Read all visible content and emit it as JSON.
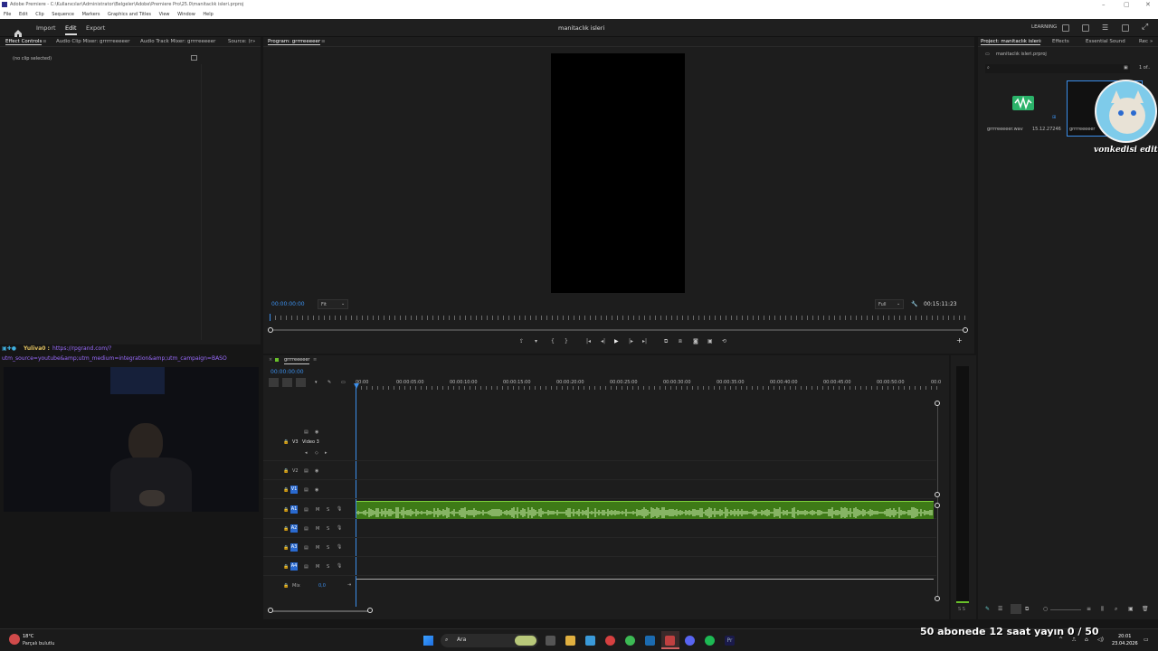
{
  "window": {
    "title": "Adobe Premiere - C:\\Kullanıcılar\\Administrator\\Belgeler\\Adobe\\Premiere Pro\\25.0\\manitaclık isleri.prproj"
  },
  "menu": [
    "File",
    "Edit",
    "Clip",
    "Sequence",
    "Markers",
    "Graphics and Titles",
    "View",
    "Window",
    "Help"
  ],
  "appbar": {
    "tabs": [
      "Import",
      "Edit",
      "Export"
    ],
    "project_title": "manitaclık isleri",
    "learning": "LEARNING"
  },
  "left_panel": {
    "tabs": [
      "Effect Controls",
      "Audio Clip Mixer: grrrrreeeeer",
      "Audio Track Mixer: grrrreeeeer",
      "Source: (r"
    ],
    "no_clip": "(no clip selected)"
  },
  "overlay": {
    "chat_user": "Yuliva0 :",
    "chat_link": "https://rpgrand.com/?",
    "chat_link_2": "utm_source=youtube&amp;utm_medium=integration&amp;utm_campaign=BASO",
    "stream_banner": "50 abonede 12 saat yayın 0 / 50",
    "streamer_tag": "vonkedisi edit"
  },
  "program": {
    "title": "Program: grrrreeeeer",
    "timecode": "00:00:00:00",
    "fit": "Fit",
    "quality": "Full",
    "duration": "00:15:11:23"
  },
  "timeline": {
    "sequence_name": "grrrreeeeer",
    "timecode": "00:00:00:00",
    "ruler_labels": [
      "00:00",
      "00:00:05:00",
      "00:00:10:00",
      "00:00:15:00",
      "00:00:20:00",
      "00:00:25:00",
      "00:00:30:00",
      "00:00:35:00",
      "00:00:40:00",
      "00:00:45:00",
      "00:00:50:00",
      "00:0"
    ],
    "video_tracks": [
      "V3",
      "V2",
      "V1"
    ],
    "video3_name": "Video 3",
    "audio_tracks": [
      "A1",
      "A2",
      "A3",
      "A4"
    ],
    "mix_label": "Mix",
    "mix_value": "0,0"
  },
  "project": {
    "tabs": [
      "Project: manitaclık isleri",
      "Effects",
      "Essential Sound",
      "Rec"
    ],
    "file": "manitaclık isleri.prproj",
    "count": "1 of..",
    "items": [
      {
        "name": "grrrreeeeer.wav",
        "duration": "15.12.27246"
      },
      {
        "name": "grrrreeeeer",
        "duration": ""
      }
    ]
  },
  "taskbar": {
    "weather_temp": "18°C",
    "weather_desc": "Parçalı bulutlu",
    "search": "Ara",
    "time": "20:01",
    "date": "23.04.2026"
  },
  "colors": {
    "accent_blue": "#2a6ad0",
    "timecode_blue": "#3b8eea",
    "audio_green": "#69c12a",
    "chat_purple": "#9b6bff"
  }
}
